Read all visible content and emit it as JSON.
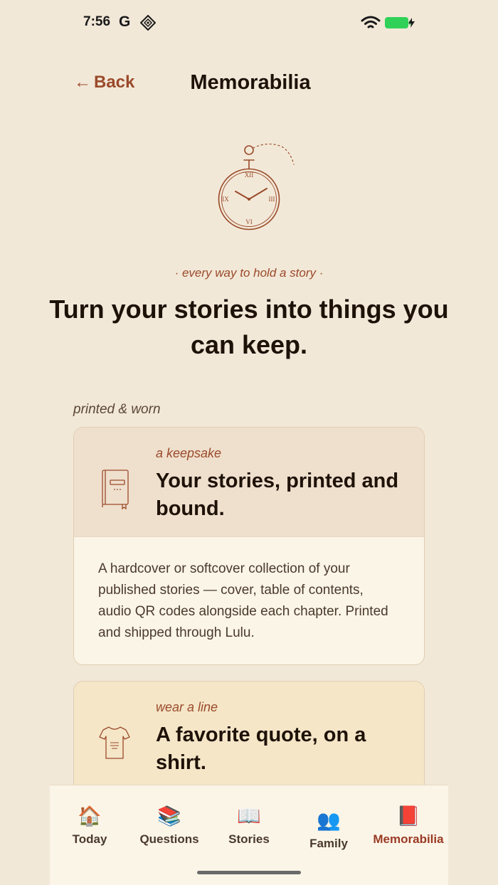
{
  "status": {
    "time": "7:56",
    "g_label": "G",
    "battery_color": "#30d158"
  },
  "header": {
    "back_arrow": "←",
    "back_label": "Back",
    "title": "Memorabilia"
  },
  "hero": {
    "eyebrow": "· every way to hold a story ·",
    "title": "Turn your stories into things you can keep.",
    "illustration": "pocket-watch-icon"
  },
  "section": {
    "label": "printed & worn"
  },
  "cards": [
    {
      "kicker": "a keepsake",
      "title": "Your stories, printed and bound.",
      "body": "A hardcover or softcover collection of your published stories — cover, table of contents, audio QR codes alongside each chapter. Printed and shipped through Lulu.",
      "icon": "book-icon"
    },
    {
      "kicker": "wear a line",
      "title": "A favorite quote, on a shirt.",
      "icon": "tshirt-icon"
    }
  ],
  "tabs": [
    {
      "label": "Today",
      "icon": "🏠"
    },
    {
      "label": "Questions",
      "icon": "📚"
    },
    {
      "label": "Stories",
      "icon": "📖"
    },
    {
      "label": "Family",
      "icon": "👥"
    },
    {
      "label": "Memorabilia",
      "icon": "📕",
      "active": true
    }
  ],
  "colors": {
    "background": "#f2e8d8",
    "accent": "#9a4a2a",
    "card_1_head": "#efdfcd",
    "card_2_head": "#f5e6c8"
  }
}
